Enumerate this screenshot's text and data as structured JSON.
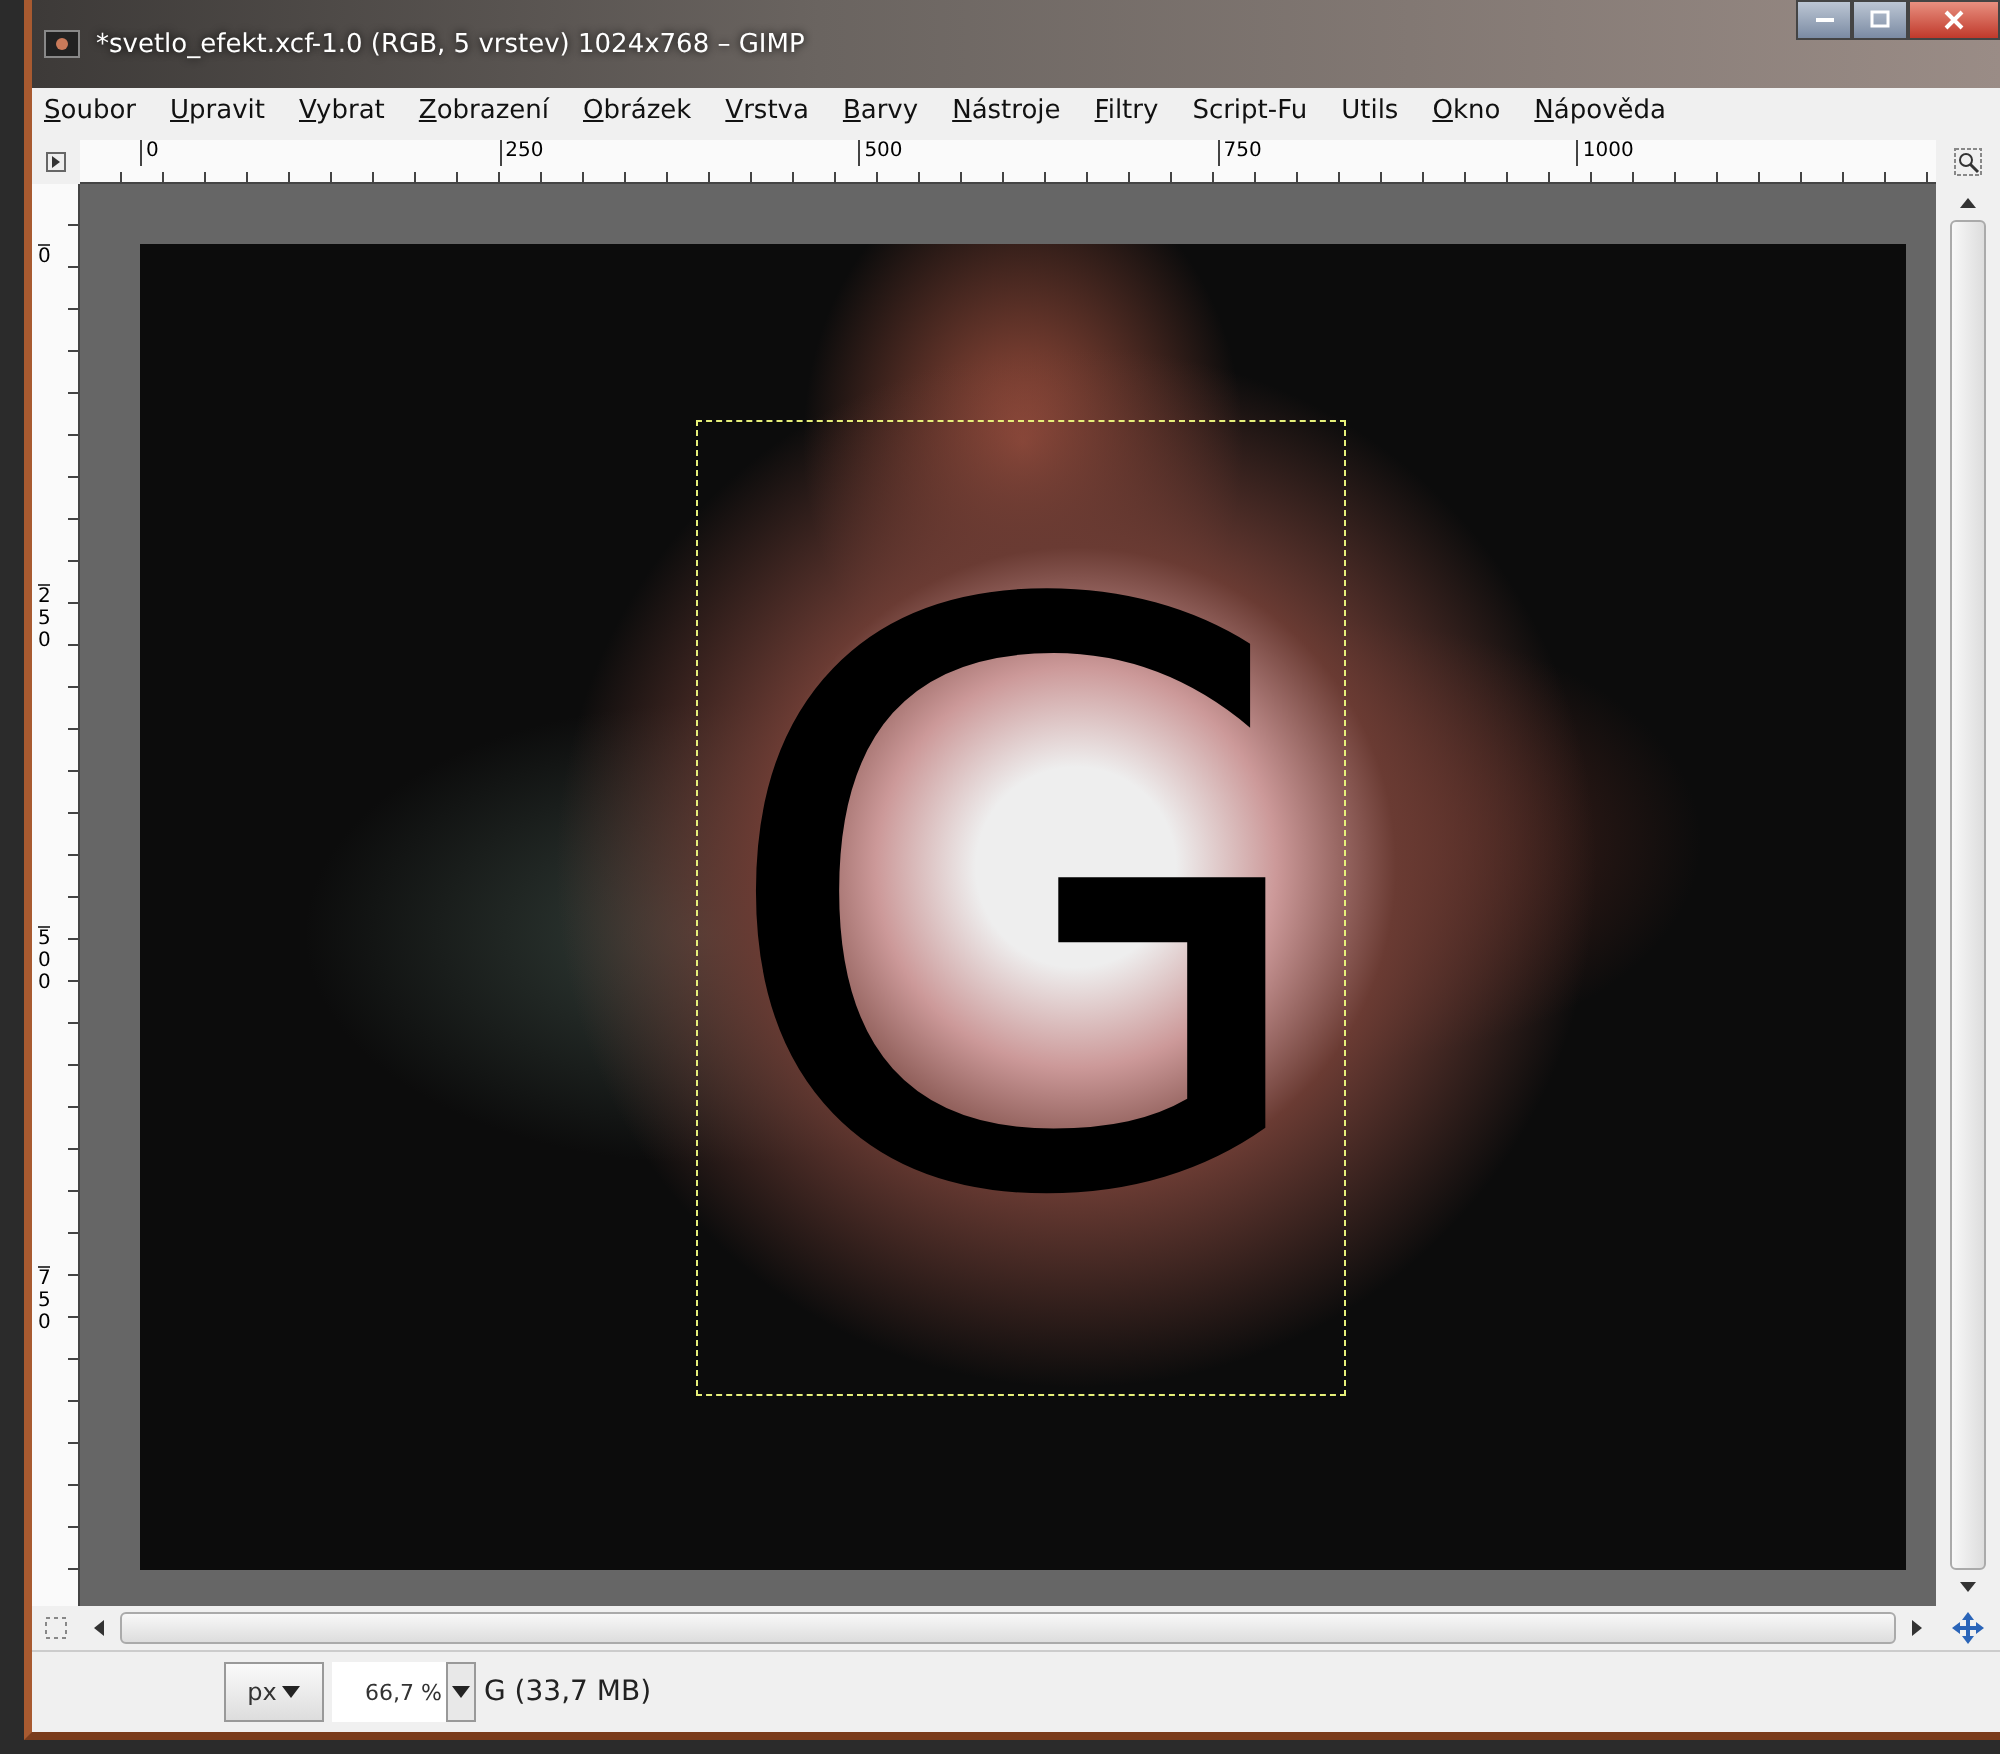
{
  "window": {
    "title": "*svetlo_efekt.xcf-1.0 (RGB, 5 vrstev) 1024x768 – GIMP"
  },
  "menu": [
    {
      "label": "Soubor",
      "mnemonic": true
    },
    {
      "label": "Upravit",
      "mnemonic": true
    },
    {
      "label": "Vybrat",
      "mnemonic": true
    },
    {
      "label": "Zobrazení",
      "mnemonic": true
    },
    {
      "label": "Obrázek",
      "mnemonic": true
    },
    {
      "label": "Vrstva",
      "mnemonic": true
    },
    {
      "label": "Barvy",
      "mnemonic": true
    },
    {
      "label": "Nástroje",
      "mnemonic": true
    },
    {
      "label": "Filtry",
      "mnemonic": true
    },
    {
      "label": "Script-Fu",
      "mnemonic": false
    },
    {
      "label": "Utils",
      "mnemonic": false
    },
    {
      "label": "Okno",
      "mnemonic": true
    },
    {
      "label": "Nápověda",
      "mnemonic": true
    }
  ],
  "h_ruler": {
    "labels": [
      "0",
      "250",
      "500",
      "750",
      "1000"
    ]
  },
  "v_ruler": {
    "labels": [
      "0",
      "250",
      "500",
      "750"
    ]
  },
  "canvas": {
    "image_text": "G"
  },
  "status_bar": {
    "unit": "px",
    "zoom": "66,7 %",
    "info": "G (33,7 MB)"
  }
}
